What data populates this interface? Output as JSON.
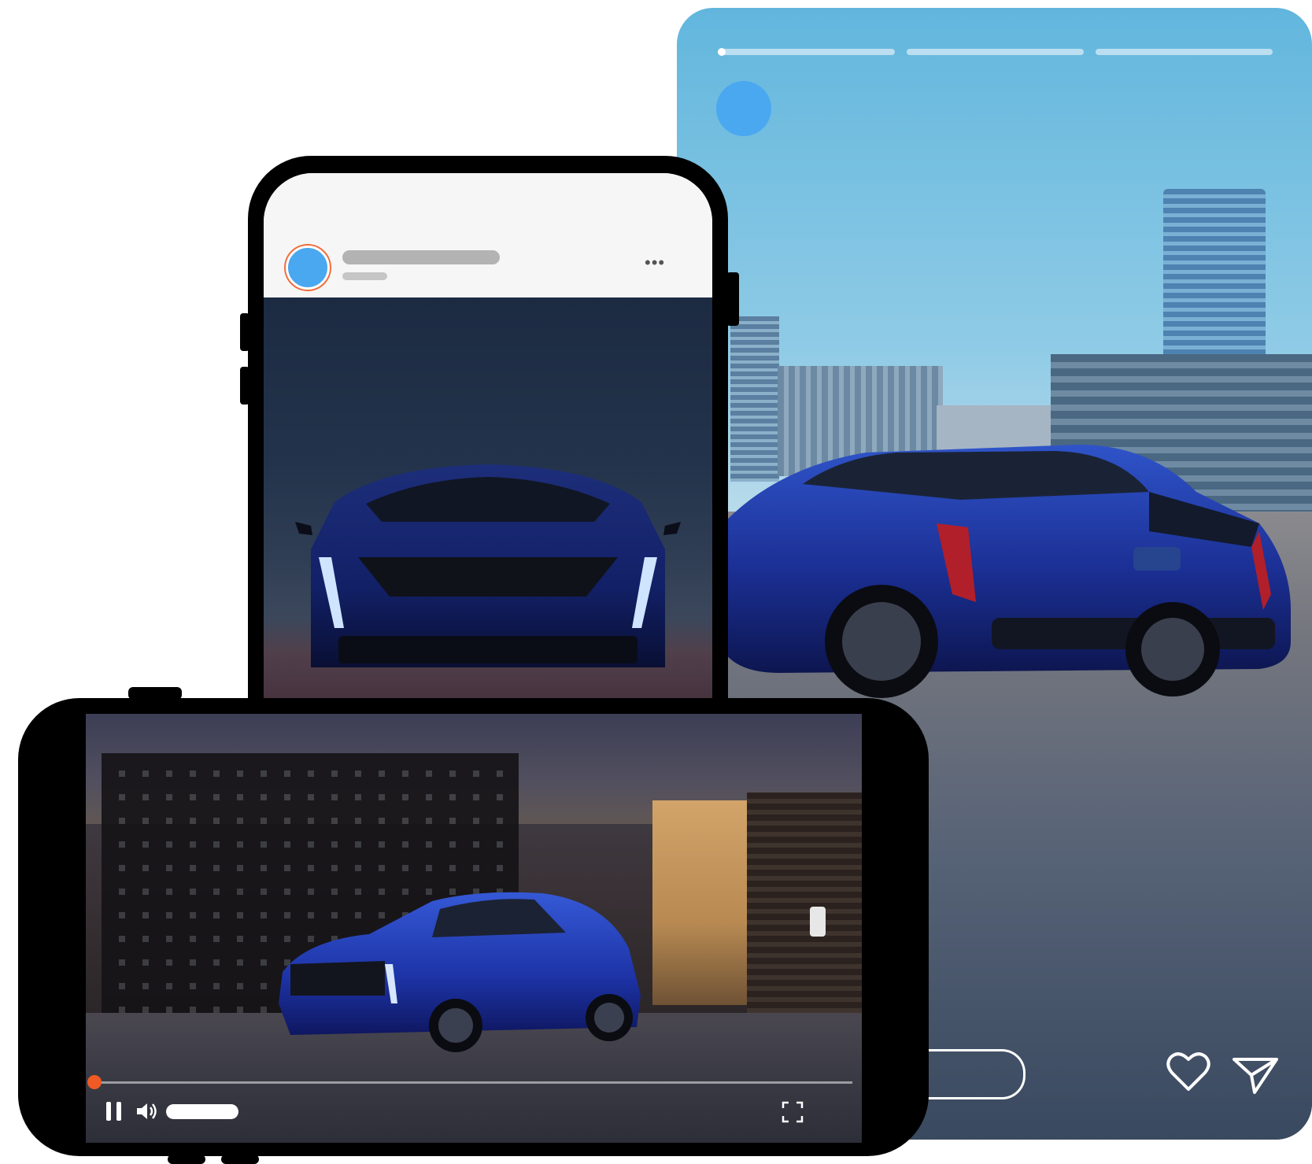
{
  "story": {
    "segments": 3,
    "actions": {
      "like_icon": "heart-icon",
      "share_icon": "send-icon"
    }
  },
  "portrait_post": {
    "more_label": "•••",
    "accent_ring": "#ef6d3b",
    "avatar_color": "#4aa8f0"
  },
  "video_player": {
    "progress_fraction": 0.0,
    "playhead_color": "#ef5a25",
    "controls": {
      "pause_icon": "pause-icon",
      "volume_icon": "volume-icon",
      "fullscreen_icon": "fullscreen-icon"
    }
  }
}
